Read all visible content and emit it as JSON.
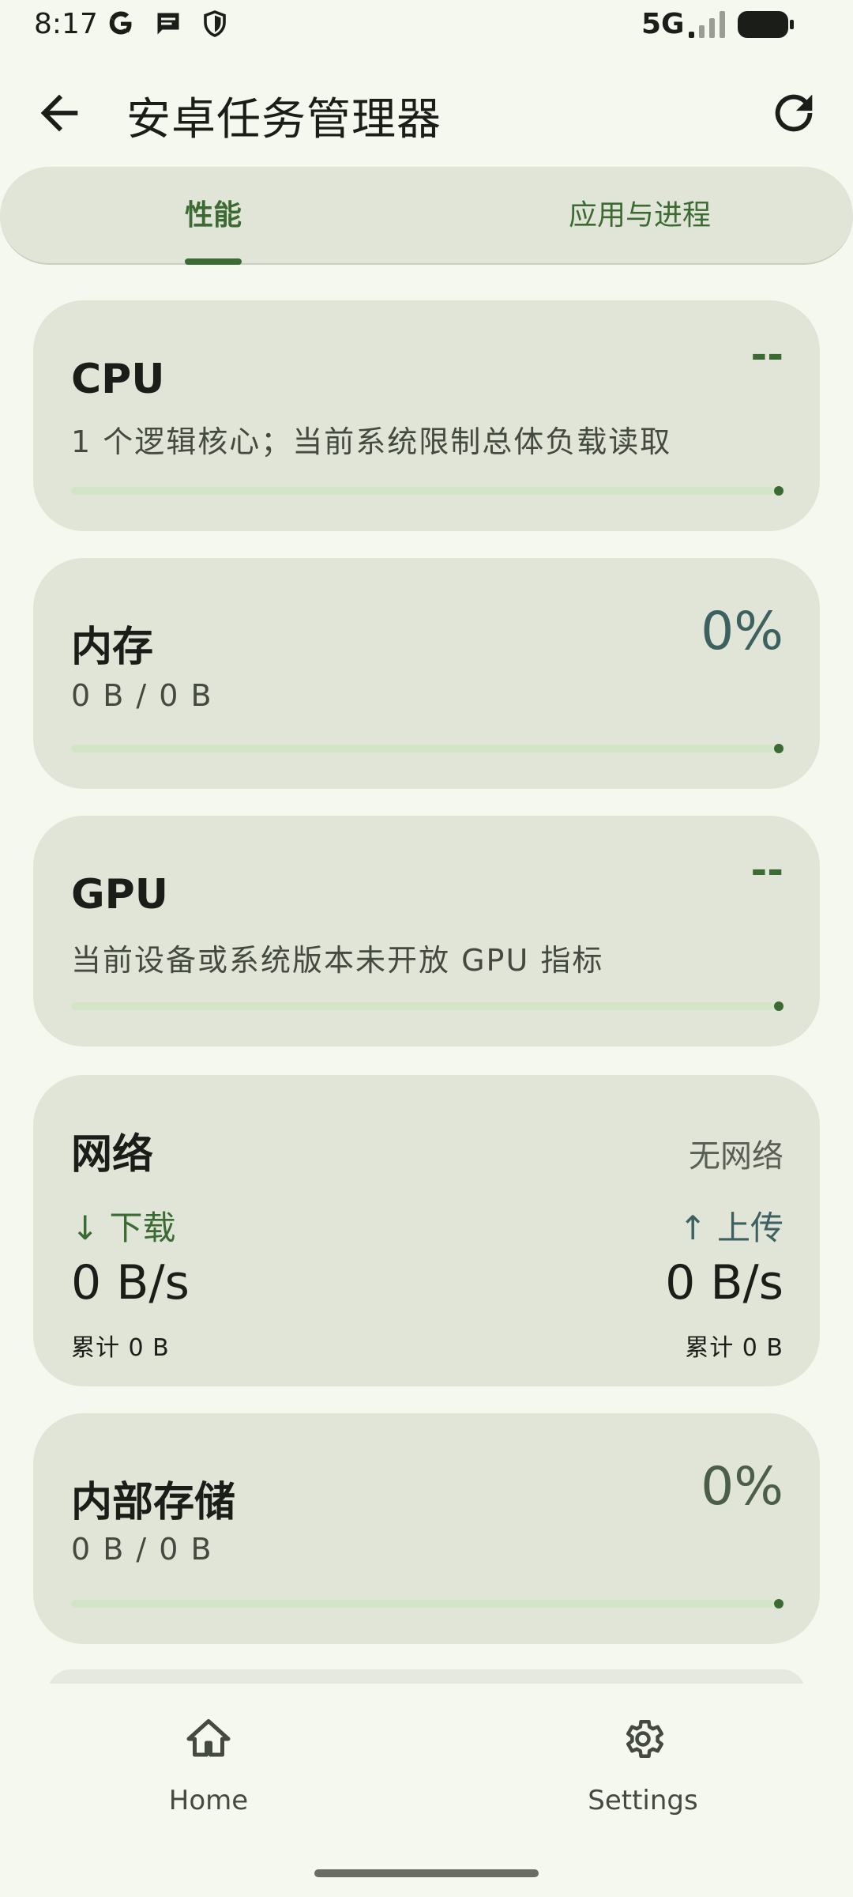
{
  "status_bar": {
    "time": "8:17",
    "network_type": "5G",
    "icons": [
      "google-icon",
      "message-icon",
      "shield-icon",
      "signal-icon",
      "battery-icon"
    ]
  },
  "app_bar": {
    "title": "安卓任务管理器",
    "back_icon": "back-arrow-icon",
    "refresh_icon": "refresh-icon"
  },
  "tabs": [
    {
      "label": "性能",
      "selected": true
    },
    {
      "label": "应用与进程",
      "selected": false
    }
  ],
  "cards": {
    "cpu": {
      "title": "CPU",
      "subtitle": "1 个逻辑核心；当前系统限制总体负载读取",
      "value": "--",
      "progress": 0
    },
    "memory": {
      "title": "内存",
      "subtitle": "0 B / 0 B",
      "value": "0%",
      "progress": 0
    },
    "gpu": {
      "title": "GPU",
      "subtitle": "当前设备或系统版本未开放 GPU 指标",
      "value": "--",
      "progress": 0
    },
    "network": {
      "title": "网络",
      "status": "无网络",
      "download_label": "↓ 下载",
      "upload_label": "↑ 上传",
      "download_rate": "0 B/s",
      "upload_rate": "0 B/s",
      "download_total": "累计 0 B",
      "upload_total": "累计 0 B"
    },
    "storage": {
      "title": "内部存储",
      "subtitle": "0 B / 0 B",
      "value": "0%",
      "progress": 0
    }
  },
  "bottom_nav": [
    {
      "label": "Home",
      "icon": "home-icon"
    },
    {
      "label": "Settings",
      "icon": "gear-icon"
    }
  ],
  "colors": {
    "background": "#f5f8ef",
    "card": "#e0e5d8",
    "accent": "#3b6b32",
    "progress_track": "#d3e5c6"
  }
}
